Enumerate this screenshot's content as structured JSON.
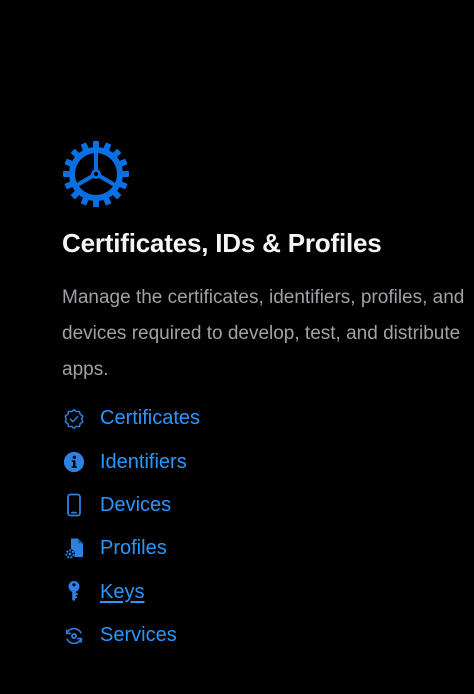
{
  "section": {
    "icon": "gear-icon",
    "title": "Certificates, IDs & Profiles",
    "description": "Manage the certificates, identifiers, profiles, and devices required to develop, test, and distribute apps."
  },
  "links": [
    {
      "label": "Certificates",
      "icon": "certificate-badge-icon"
    },
    {
      "label": "Identifiers",
      "icon": "info-circle-icon"
    },
    {
      "label": "Devices",
      "icon": "phone-icon"
    },
    {
      "label": "Profiles",
      "icon": "document-gear-icon"
    },
    {
      "label": "Keys",
      "icon": "key-icon"
    },
    {
      "label": "Services",
      "icon": "services-icon"
    }
  ],
  "colors": {
    "background": "#000000",
    "accent": "#2997ff",
    "icon_blue": "#0a6fe0",
    "title": "#f5f5f7",
    "description": "#a1a1a6"
  }
}
